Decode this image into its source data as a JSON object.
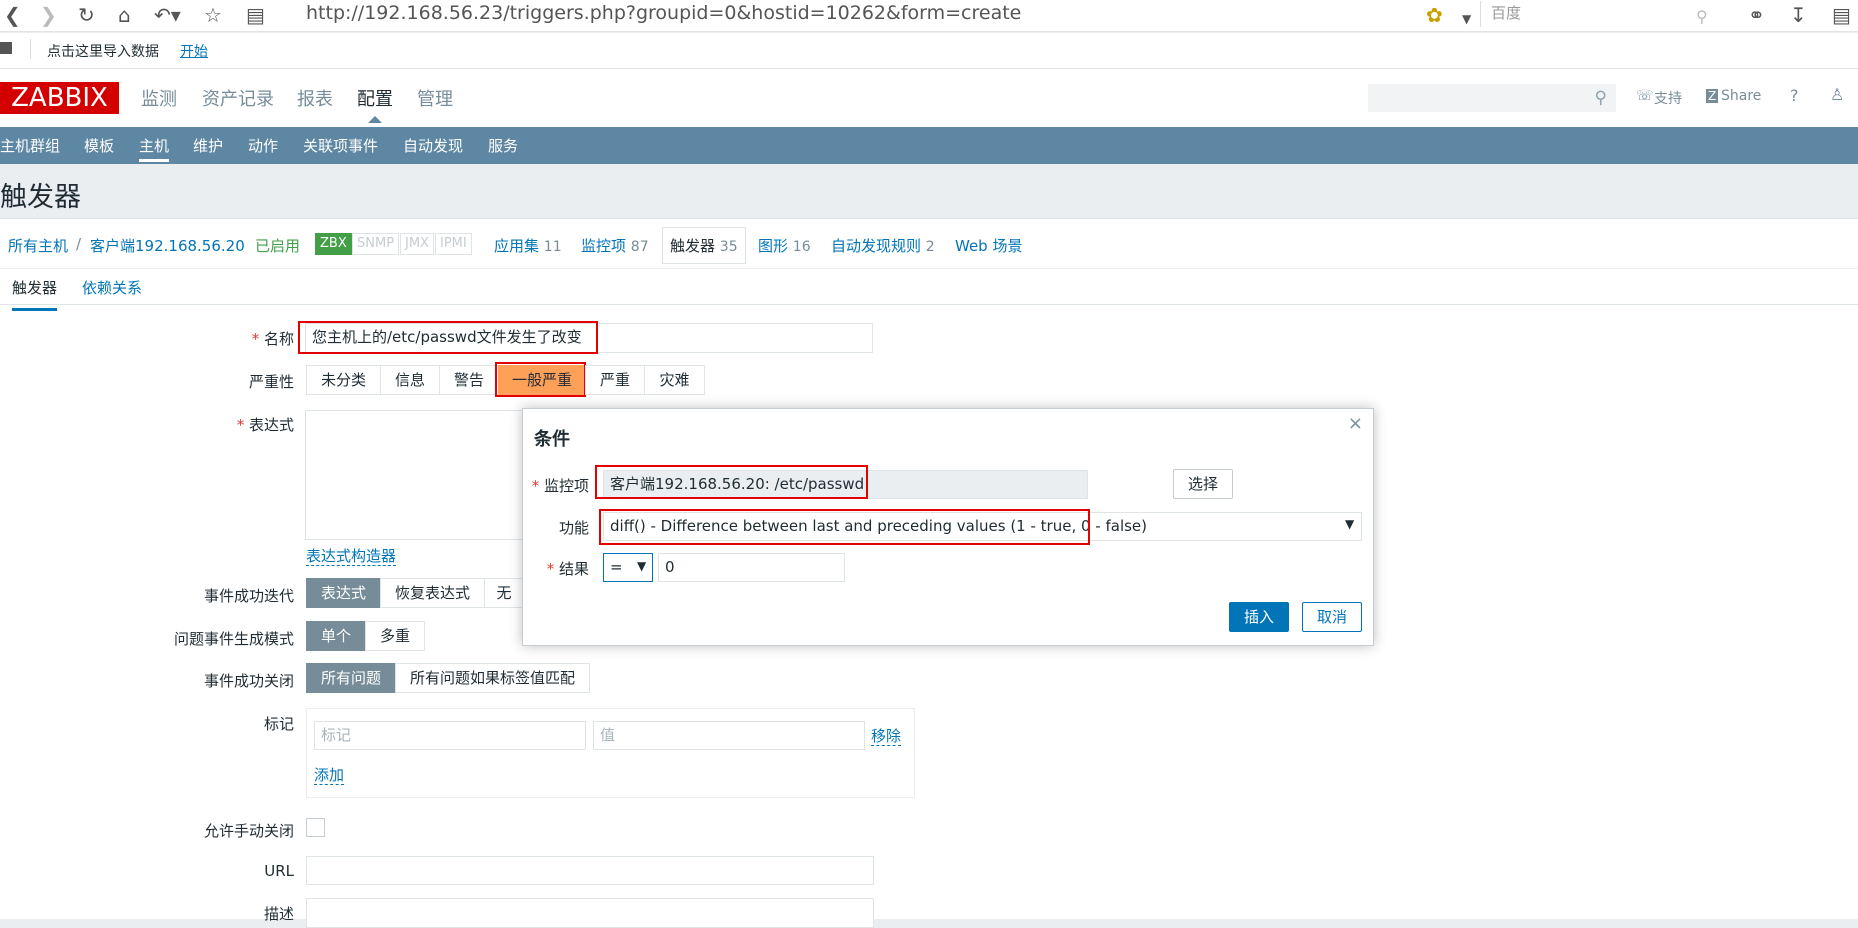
{
  "browser": {
    "url": "http://192.168.56.23/triggers.php?groupid=0&hostid=10262&form=create",
    "search_placeholder": "百度",
    "bookmark_text": "点击这里导入数据",
    "bookmark_link": "开始"
  },
  "header": {
    "logo": "ZABBIX",
    "nav": [
      "监测",
      "资产记录",
      "报表",
      "配置",
      "管理"
    ],
    "support": "支持",
    "share": "Share",
    "help": "?"
  },
  "subnav": [
    "主机群组",
    "模板",
    "主机",
    "维护",
    "动作",
    "关联项事件",
    "自动发现",
    "服务"
  ],
  "page_title": "触发器",
  "host_nav": {
    "all_hosts": "所有主机",
    "sep": "/",
    "host": "客户端192.168.56.20",
    "status": "已启用",
    "badges": [
      "ZBX",
      "SNMP",
      "JMX",
      "IPMI"
    ],
    "items": [
      {
        "label": "应用集",
        "count": "11"
      },
      {
        "label": "监控项",
        "count": "87"
      },
      {
        "label": "触发器",
        "count": "35"
      },
      {
        "label": "图形",
        "count": "16"
      },
      {
        "label": "自动发现规则",
        "count": "2"
      },
      {
        "label": "Web 场景",
        "count": ""
      }
    ]
  },
  "tabs": [
    "触发器",
    "依赖关系"
  ],
  "form": {
    "name_label": "名称",
    "name_value": "您主机上的/etc/passwd文件发生了改变",
    "severity_label": "严重性",
    "severities": [
      "未分类",
      "信息",
      "警告",
      "一般严重",
      "严重",
      "灾难"
    ],
    "expression_label": "表达式",
    "expr_builder": "表达式构造器",
    "ok_event_label": "事件成功迭代",
    "ok_event_options": [
      "表达式",
      "恢复表达式",
      "无"
    ],
    "problem_mode_label": "问题事件生成模式",
    "problem_mode_options": [
      "单个",
      "多重"
    ],
    "ok_close_label": "事件成功关闭",
    "ok_close_options": [
      "所有问题",
      "所有问题如果标签值匹配"
    ],
    "tags_label": "标记",
    "tag_placeholder": "标记",
    "value_placeholder": "值",
    "remove": "移除",
    "add": "添加",
    "manual_close_label": "允许手动关闭",
    "url_label": "URL",
    "desc_label": "描述"
  },
  "dialog": {
    "title": "条件",
    "close": "×",
    "item_label": "监控项",
    "item_value": "客户端192.168.56.20: /etc/passwd",
    "select": "选择",
    "function_label": "功能",
    "function_value": "diff() - Difference between last and preceding values (1 - true, 0 - false)",
    "result_label": "结果",
    "operator": "=",
    "result_value": "0",
    "insert": "插入",
    "cancel": "取消"
  }
}
